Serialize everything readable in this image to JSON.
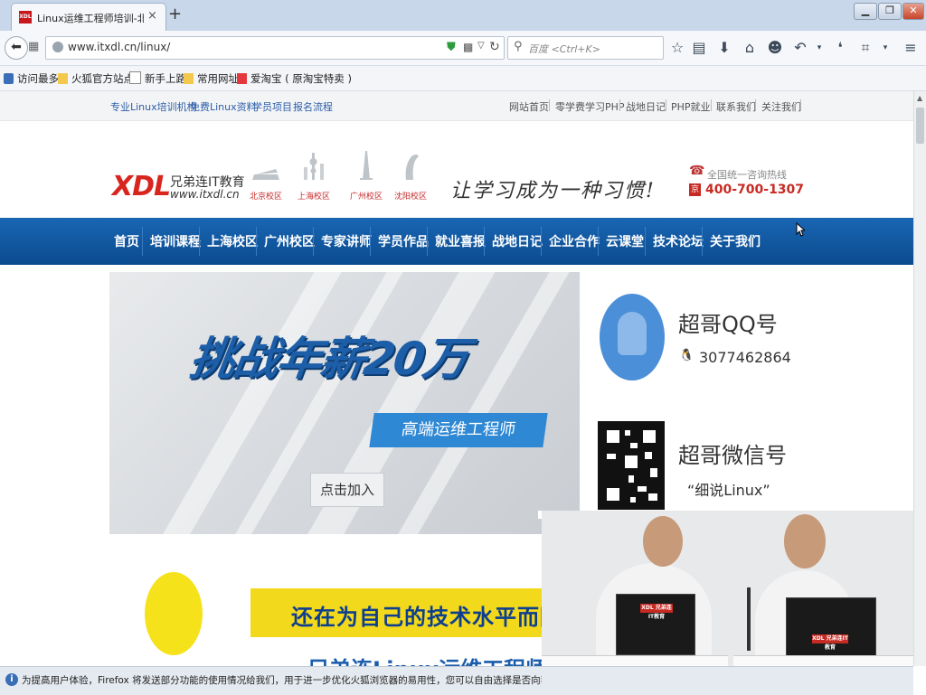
{
  "browser": {
    "tab_title": "Linux运维工程师培训-北...",
    "tab_favicon_text": "XDL",
    "tab_close": "×",
    "new_tab": "+",
    "window_buttons": [
      "▁",
      "❐",
      "✕"
    ],
    "url": "www.itxdl.cn/linux/",
    "search_placeholder": "百度 <Ctrl+K>",
    "toolbar_icons": [
      "star-icon",
      "reading-list-icon",
      "download-icon",
      "home-icon",
      "smiley-icon",
      "undo-icon",
      "chat-icon",
      "crop-icon",
      "menu-icon"
    ]
  },
  "bookmarks": [
    {
      "label": "访问最多",
      "icon": "most-visited-icon",
      "color": "#3a6fb8"
    },
    {
      "label": "火狐官方站点",
      "icon": "folder-icon",
      "color": "#f2c94c"
    },
    {
      "label": "新手上路",
      "icon": "page-icon",
      "color": "#ffffff"
    },
    {
      "label": "常用网址",
      "icon": "folder-icon",
      "color": "#f2c94c"
    },
    {
      "label": "爱淘宝 ( 原淘宝特卖 )",
      "icon": "taobao-icon",
      "color": "#e4393c"
    }
  ],
  "site": {
    "top_links_left": [
      "专业Linux培训机构",
      "免费Linux资料",
      "学员项目",
      "报名流程"
    ],
    "top_links_right": [
      "网站首页",
      "零学费学习PHP",
      "战地日记",
      "PHP就业",
      "联系我们",
      "关注我们"
    ],
    "logo_mark": "XDL",
    "logo_name": "兄弟连IT教育",
    "logo_url": "www.itxdl.cn",
    "campuses": [
      "北京校区",
      "上海校区",
      "广州校区",
      "沈阳校区"
    ],
    "slogan": "让学习成为一种习惯!",
    "hotline_label": "全国统一咨询热线",
    "hotline_badge": "京",
    "hotline_number": "400-700-1307",
    "nav": [
      "首页",
      "培训课程",
      "上海校区",
      "广州校区",
      "专家讲师",
      "学员作品",
      "就业喜报",
      "战地日记",
      "企业合作",
      "云课堂",
      "技术论坛",
      "关于我们"
    ],
    "banner": {
      "headline": "挑战年薪20万",
      "subtitle": "高端运维工程师",
      "button": "点击加入"
    },
    "contact": {
      "qq_title": "超哥QQ号",
      "qq_number": "3077462864",
      "wechat_title": "超哥微信号",
      "wechat_id": "“细说Linux”"
    },
    "yellow_banner_text": "还在为自己的技术水平而困扰？",
    "partial_heading": "兄弟连Linux运维工程师",
    "laptop_logo": "XDL 兄弟连IT教育"
  },
  "infobar": {
    "icon": "i",
    "text": "为提高用户体验，Firefox 将发送部分功能的使用情况给我们，用于进一步优化火狐浏览器的易用性，您可以自由选择是否向我们分享数据。"
  },
  "colors": {
    "nav_blue": "#0d559e",
    "brand_red": "#d8261f",
    "banner_blue": "#1d5ea8",
    "yellow": "#f3d91b"
  }
}
